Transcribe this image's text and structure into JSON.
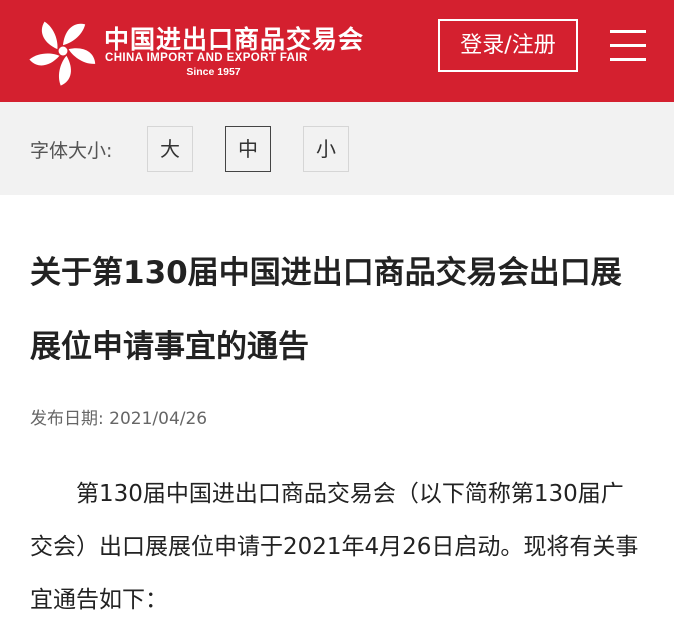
{
  "header": {
    "logo_cn": "中国进出口商品交易会",
    "logo_en": "CHINA IMPORT AND EXPORT FAIR",
    "logo_since": "Since 1957",
    "login_label": "登录/注册",
    "menu_icon": "hamburger-menu-icon",
    "background_color": "#d4202f"
  },
  "font_size": {
    "label": "字体大小:",
    "options": [
      "大",
      "中",
      "小"
    ],
    "selected": "中"
  },
  "article": {
    "title": "关于第130届中国进出口商品交易会出口展展位申请事宜的通告",
    "date": "发布日期: 2021/04/26",
    "paragraph": "第130届中国进出口商品交易会（以下简称第130届广交会）出口展展位申请于2021年4月26日启动。现将有关事宜通告如下："
  }
}
